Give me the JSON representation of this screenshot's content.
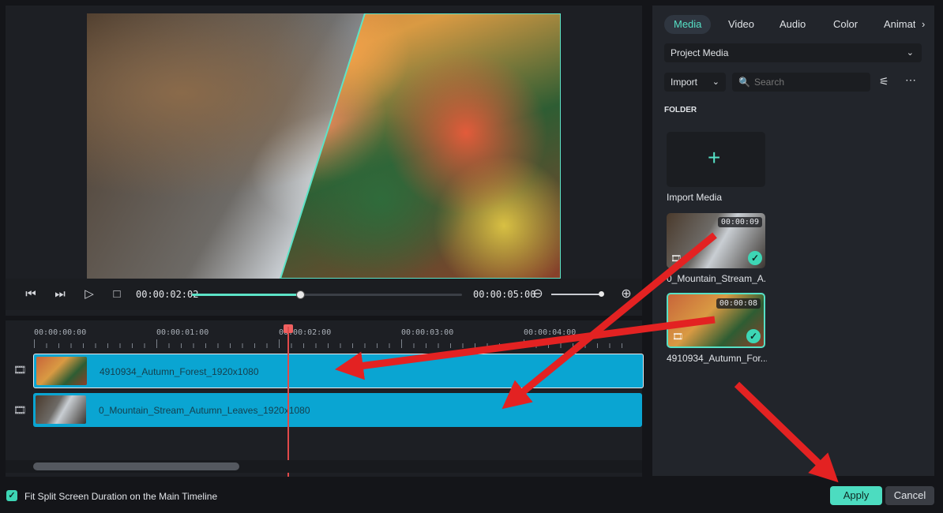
{
  "preview": {
    "current_time": "00:00:02:02",
    "total_time": "00:00:05:00",
    "progress": 0.4
  },
  "timeline": {
    "ruler_labels": [
      "00:00:00:00",
      "00:00:01:00",
      "00:00:02:00",
      "00:00:03:00",
      "00:00:04:00"
    ],
    "tracks": [
      {
        "clip_name": "4910934_Autumn_Forest_1920x1080"
      },
      {
        "clip_name": "0_Mountain_Stream_Autumn_Leaves_1920x1080"
      }
    ]
  },
  "media_panel": {
    "tabs": [
      "Media",
      "Video",
      "Audio",
      "Color",
      "Animat"
    ],
    "source_dropdown": "Project Media",
    "import_label": "Import",
    "search_placeholder": "Search",
    "folder_heading": "FOLDER",
    "import_media_label": "Import Media",
    "items": [
      {
        "name": "0_Mountain_Stream_A...",
        "duration": "00:00:09"
      },
      {
        "name": "4910934_Autumn_For...",
        "duration": "00:00:08"
      }
    ]
  },
  "footer": {
    "fit_checkbox_label": "Fit Split Screen Duration on the Main Timeline",
    "fit_checked": true,
    "apply_label": "Apply",
    "cancel_label": "Cancel"
  },
  "colors": {
    "accent": "#56e0c5",
    "clip": "#0aa5d2",
    "playhead": "#e24a4a",
    "annotation_arrow": "#e32222"
  }
}
